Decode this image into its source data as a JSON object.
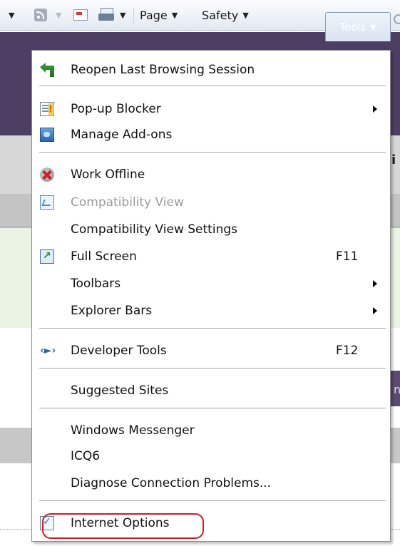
{
  "command_bar": {
    "page_label": "Page",
    "safety_label": "Safety",
    "tools_label": "Tools"
  },
  "menu": {
    "items": [
      {
        "label": "Reopen Last Browsing Session",
        "icon": "reopen-session-icon"
      },
      {
        "label": "Pop-up Blocker",
        "icon": "popup-blocker-icon",
        "submenu": true
      },
      {
        "label": "Manage Add-ons",
        "icon": "manage-addons-icon"
      },
      {
        "label": "Work Offline",
        "icon": "work-offline-icon"
      },
      {
        "label": "Compatibility View",
        "icon": "compatibility-view-icon",
        "disabled": true
      },
      {
        "label": "Compatibility View Settings"
      },
      {
        "label": "Full Screen",
        "icon": "full-screen-icon",
        "shortcut": "F11"
      },
      {
        "label": "Toolbars",
        "submenu": true
      },
      {
        "label": "Explorer Bars",
        "submenu": true
      },
      {
        "label": "Developer Tools",
        "icon": "developer-tools-icon",
        "shortcut": "F12"
      },
      {
        "label": "Suggested Sites"
      },
      {
        "label": "Windows Messenger"
      },
      {
        "label": "ICQ6"
      },
      {
        "label": "Diagnose Connection Problems..."
      },
      {
        "label": "Internet Options",
        "icon": "internet-options-icon",
        "highlighted": true
      }
    ]
  },
  "page_fragments": {
    "right_edge_char": "i",
    "right_edge_char2": "n"
  },
  "colors": {
    "highlight_ring": "#e0121a",
    "tools_button_text": "#ffffff",
    "disabled_text": "#9a9a9a"
  }
}
